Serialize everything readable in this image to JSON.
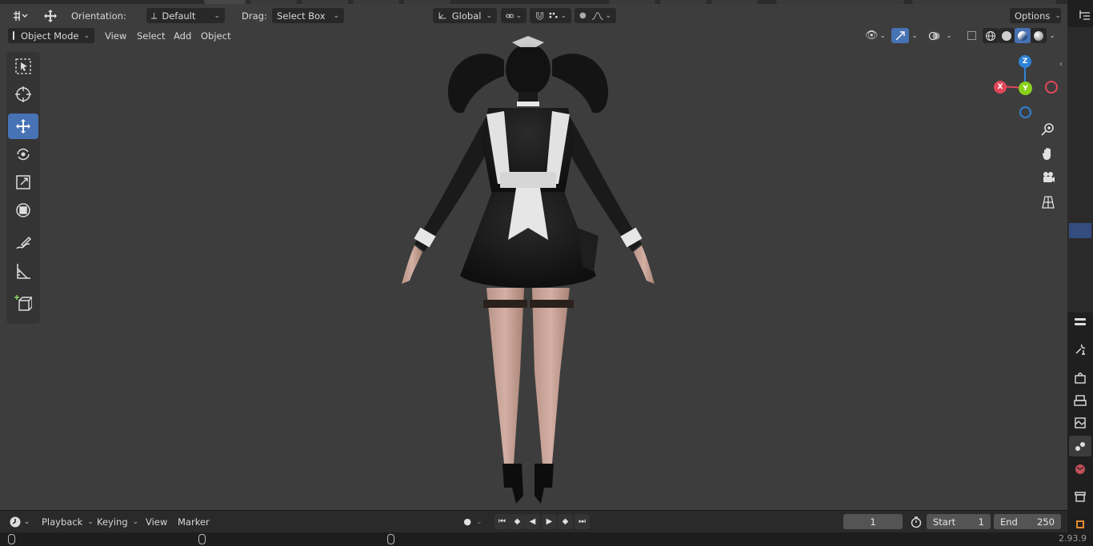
{
  "header": {
    "orientation_label": "Orientation:",
    "orientation_value": "Default",
    "drag_label": "Drag:",
    "drag_value": "Select Box",
    "transform_orientation": "Global",
    "options_label": "Options"
  },
  "viewport_header": {
    "mode": "Object Mode",
    "menus": [
      "View",
      "Select",
      "Add",
      "Object"
    ]
  },
  "gizmo": {
    "x_label": "X",
    "y_label": "Y",
    "z_label": "Z",
    "colors": {
      "x": "#e2485a",
      "y": "#8ad11a",
      "z": "#2f83d6"
    }
  },
  "timeline": {
    "menus": [
      "Playback",
      "Keying",
      "View",
      "Marker"
    ],
    "current_frame": "1",
    "start_label": "Start",
    "start_value": "1",
    "end_label": "End",
    "end_value": "250"
  },
  "status": {
    "version": "2.93.9"
  },
  "colors": {
    "accent": "#4772b3",
    "viewport_bg": "#3d3d3d",
    "header_bg": "#282828"
  },
  "icons": {
    "toolbar": [
      "select-box-icon",
      "cursor-icon",
      "move-icon",
      "rotate-icon",
      "scale-icon",
      "transform-icon",
      "annotate-icon",
      "measure-icon",
      "add-cube-icon"
    ],
    "navigation": [
      "zoom-icon",
      "pan-hand-icon",
      "camera-icon",
      "grid-view-icon"
    ],
    "properties": [
      "tool-icon",
      "render-icon",
      "output-icon",
      "view-layer-icon",
      "scene-icon",
      "world-icon",
      "collection-icon",
      "object-icon"
    ]
  }
}
